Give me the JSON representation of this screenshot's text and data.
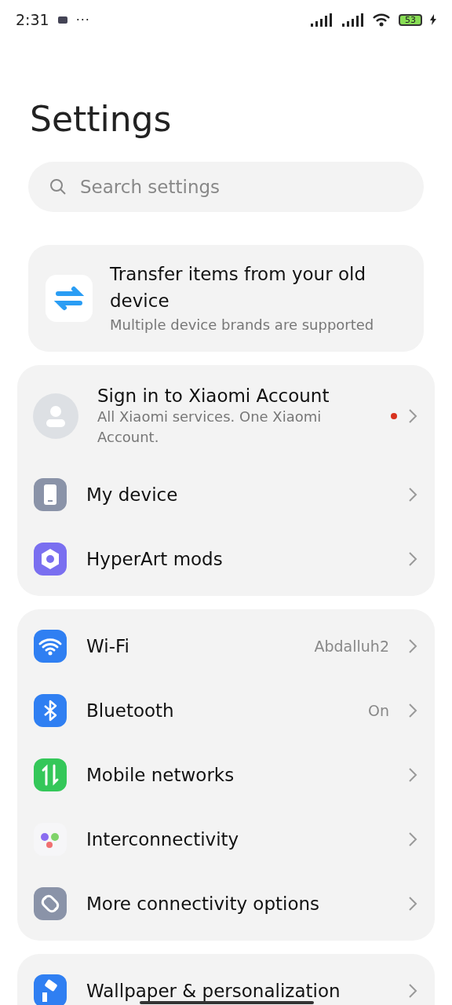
{
  "status_bar": {
    "time": "2:31",
    "more": "···",
    "battery": "53"
  },
  "title": "Settings",
  "search": {
    "placeholder": "Search settings"
  },
  "transfer_card": {
    "title": "Transfer items from your old device",
    "subtitle": "Multiple device brands are supported"
  },
  "groups": [
    {
      "items": [
        {
          "kind": "account",
          "label": "Sign in to Xiaomi Account",
          "subtitle": "All Xiaomi services. One Xiaomi Account.",
          "notification": true
        },
        {
          "kind": "item",
          "label": "My device"
        },
        {
          "kind": "item",
          "label": "HyperArt mods"
        }
      ]
    },
    {
      "items": [
        {
          "kind": "item",
          "label": "Wi-Fi",
          "value": "Abdalluh2"
        },
        {
          "kind": "item",
          "label": "Bluetooth",
          "value": "On"
        },
        {
          "kind": "item",
          "label": "Mobile networks"
        },
        {
          "kind": "item",
          "label": "Interconnectivity"
        },
        {
          "kind": "item",
          "label": "More connectivity options"
        }
      ]
    },
    {
      "items": [
        {
          "kind": "item",
          "label": "Wallpaper & personalization"
        }
      ]
    }
  ]
}
